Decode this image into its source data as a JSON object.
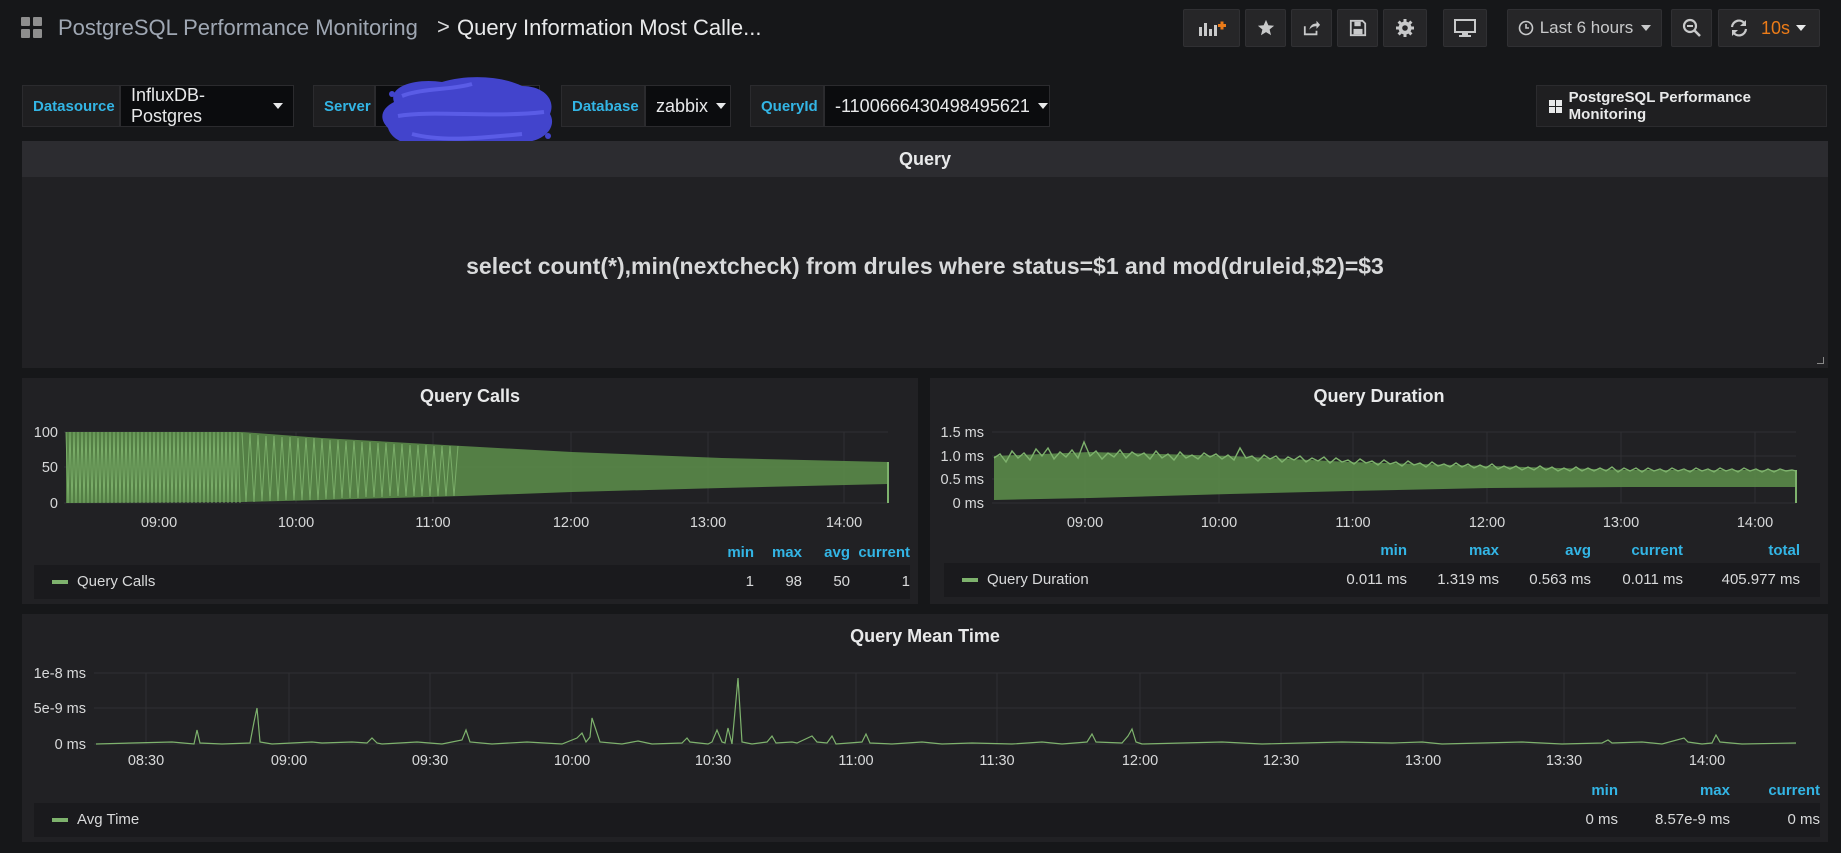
{
  "nav": {
    "breadcrumb_parent": "PostgreSQL Performance Monitoring",
    "breadcrumb_separator": ">",
    "dashboard_title": "Query Information Most Calle...",
    "time_range": "Last 6 hours",
    "refresh_interval": "10s",
    "accent_color": "#eb7b18"
  },
  "variables": [
    {
      "label": "Datasource",
      "value": "InfluxDB-Postgres"
    },
    {
      "label": "Server",
      "value": ""
    },
    {
      "label": "Database",
      "value": "zabbix"
    },
    {
      "label": "QueryId",
      "value": "-1100666430498495621"
    }
  ],
  "dashboard_link": "PostgreSQL Performance Monitoring",
  "query_panel": {
    "title": "Query",
    "text": "select count(*),min(nextcheck) from drules where status=$1 and mod(druleid,$2)=$3"
  },
  "calls_panel": {
    "title": "Query Calls",
    "y_ticks": [
      "100",
      "50",
      "0"
    ],
    "x_ticks": [
      "09:00",
      "10:00",
      "11:00",
      "12:00",
      "13:00",
      "14:00"
    ],
    "legend_headers": [
      "min",
      "max",
      "avg",
      "current"
    ],
    "series_name": "Query Calls",
    "stats": [
      "1",
      "98",
      "50",
      "1"
    ]
  },
  "duration_panel": {
    "title": "Query Duration",
    "y_ticks": [
      "1.5 ms",
      "1.0 ms",
      "0.5 ms",
      "0 ms"
    ],
    "x_ticks": [
      "09:00",
      "10:00",
      "11:00",
      "12:00",
      "13:00",
      "14:00"
    ],
    "legend_headers": [
      "min",
      "max",
      "avg",
      "current",
      "total"
    ],
    "series_name": "Query Duration",
    "stats": [
      "0.011 ms",
      "1.319 ms",
      "0.563 ms",
      "0.011 ms",
      "405.977 ms"
    ]
  },
  "mean_panel": {
    "title": "Query Mean Time",
    "y_ticks": [
      "1e-8 ms",
      "5e-9 ms",
      "0 ms"
    ],
    "x_ticks": [
      "08:30",
      "09:00",
      "09:30",
      "10:00",
      "10:30",
      "11:00",
      "11:30",
      "12:00",
      "12:30",
      "13:00",
      "13:30",
      "14:00"
    ],
    "legend_headers": [
      "min",
      "max",
      "current"
    ],
    "series_name": "Avg Time",
    "stats": [
      "0 ms",
      "8.57e-9 ms",
      "0 ms"
    ]
  },
  "chart_data": [
    {
      "type": "area",
      "title": "Query Calls",
      "series": [
        {
          "name": "Query Calls"
        }
      ],
      "x": [
        "08:20",
        "09:00",
        "10:00",
        "11:00",
        "12:00",
        "13:00",
        "14:00",
        "14:20"
      ],
      "upper_envelope": [
        98,
        98,
        93,
        87,
        81,
        76,
        72,
        70
      ],
      "lower_envelope": [
        1,
        5,
        10,
        18,
        26,
        32,
        36,
        38
      ],
      "ylim": [
        0,
        100
      ],
      "min": 1,
      "max": 98,
      "avg": 50,
      "current": 1
    },
    {
      "type": "area",
      "title": "Query Duration",
      "series": [
        {
          "name": "Query Duration"
        }
      ],
      "unit": "ms",
      "x": [
        "08:20",
        "09:00",
        "10:00",
        "11:00",
        "12:00",
        "13:00",
        "14:00",
        "14:20"
      ],
      "upper_envelope": [
        1.15,
        1.25,
        1.15,
        1.05,
        0.95,
        0.85,
        0.8,
        0.8
      ],
      "lower_envelope": [
        0.1,
        0.12,
        0.2,
        0.3,
        0.4,
        0.45,
        0.45,
        0.45
      ],
      "ylim": [
        0,
        1.5
      ],
      "min": 0.011,
      "max": 1.319,
      "avg": 0.563,
      "current": 0.011,
      "total": 405.977
    },
    {
      "type": "line",
      "title": "Query Mean Time",
      "series": [
        {
          "name": "Avg Time",
          "spikes": [
            {
              "x": "08:42",
              "y": 2e-09
            },
            {
              "x": "08:54",
              "y": 5e-09
            },
            {
              "x": "09:39",
              "y": 2e-09
            },
            {
              "x": "10:04",
              "y": 2e-09
            },
            {
              "x": "10:05",
              "y": 3.5e-09
            },
            {
              "x": "10:24",
              "y": 2e-09
            },
            {
              "x": "10:30",
              "y": 8.57e-09
            },
            {
              "x": "10:33",
              "y": 1.5e-09
            },
            {
              "x": "11:02",
              "y": 1.5e-09
            },
            {
              "x": "11:54",
              "y": 2.5e-09
            },
            {
              "x": "12:00",
              "y": 1e-09
            },
            {
              "x": "14:00",
              "y": 1e-09
            }
          ]
        }
      ],
      "unit": "ms",
      "ylim": [
        0,
        1e-08
      ],
      "min": 0,
      "max": 8.57e-09,
      "current": 0
    }
  ]
}
